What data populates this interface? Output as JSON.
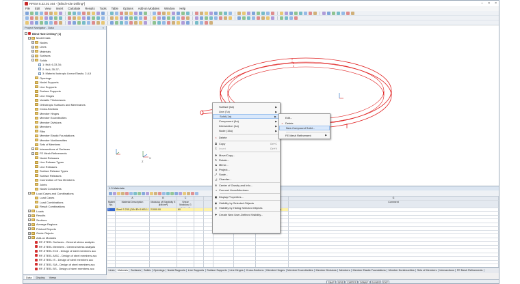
{
  "window": {
    "title": "RFEM 5.22.01 x64 - [Blind Hole Drilling*]",
    "controls": [
      "–",
      "□",
      "×"
    ]
  },
  "menu": [
    "File",
    "Edit",
    "View",
    "Insert",
    "Calculate",
    "Results",
    "Tools",
    "Table",
    "Options",
    "Add-on Modules",
    "Window",
    "Help"
  ],
  "navigator": {
    "title": "Project Navigator - Data",
    "tree": [
      {
        "label": "Blind Hole Drilling* [1]",
        "level": 0,
        "icon": "red",
        "exp": "-",
        "bold": true
      },
      {
        "label": "Model Data",
        "level": 1,
        "icon": "folder",
        "exp": "-"
      },
      {
        "label": "Nodes",
        "level": 2,
        "icon": "folder",
        "exp": "+"
      },
      {
        "label": "Lines",
        "level": 2,
        "icon": "folder",
        "exp": "+"
      },
      {
        "label": "Materials",
        "level": 2,
        "icon": "folder",
        "exp": "+"
      },
      {
        "label": "Surfaces",
        "level": 2,
        "icon": "folder",
        "exp": "+"
      },
      {
        "label": "Solids",
        "level": 2,
        "icon": "folder",
        "exp": "-"
      },
      {
        "label": "1: Null; 6,33,34;",
        "level": 3,
        "icon": "doc",
        "exp": ""
      },
      {
        "label": "2: Null; 35-37;",
        "level": 3,
        "icon": "doc",
        "exp": ""
      },
      {
        "label": "3: Material Isotropic Linear Elastic; 2,4,5",
        "level": 3,
        "icon": "doc",
        "exp": ""
      },
      {
        "label": "Openings",
        "level": 2,
        "icon": "folder",
        "exp": ""
      },
      {
        "label": "Nodal Supports",
        "level": 2,
        "icon": "folder",
        "exp": ""
      },
      {
        "label": "Line Supports",
        "level": 2,
        "icon": "folder",
        "exp": ""
      },
      {
        "label": "Surface Supports",
        "level": 2,
        "icon": "folder",
        "exp": ""
      },
      {
        "label": "Line Hinges",
        "level": 2,
        "icon": "folder",
        "exp": ""
      },
      {
        "label": "Variable Thicknesses",
        "level": 2,
        "icon": "folder",
        "exp": ""
      },
      {
        "label": "Orthotropic Surfaces and Membranes",
        "level": 2,
        "icon": "folder",
        "exp": ""
      },
      {
        "label": "Cross-Sections",
        "level": 2,
        "icon": "folder",
        "exp": ""
      },
      {
        "label": "Member Hinges",
        "level": 2,
        "icon": "folder",
        "exp": ""
      },
      {
        "label": "Member Eccentricities",
        "level": 2,
        "icon": "folder",
        "exp": ""
      },
      {
        "label": "Member Divisions",
        "level": 2,
        "icon": "folder",
        "exp": ""
      },
      {
        "label": "Members",
        "level": 2,
        "icon": "folder",
        "exp": ""
      },
      {
        "label": "Ribs",
        "level": 2,
        "icon": "folder",
        "exp": ""
      },
      {
        "label": "Member Elastic Foundations",
        "level": 2,
        "icon": "folder",
        "exp": ""
      },
      {
        "label": "Member Nonlinearities",
        "level": 2,
        "icon": "folder",
        "exp": ""
      },
      {
        "label": "Sets of Members",
        "level": 2,
        "icon": "folder",
        "exp": ""
      },
      {
        "label": "Intersections of Surfaces",
        "level": 2,
        "icon": "folder",
        "exp": "+"
      },
      {
        "label": "FE Mesh Refinements",
        "level": 2,
        "icon": "folder",
        "exp": "+"
      },
      {
        "label": "Nodal Releases",
        "level": 2,
        "icon": "folder",
        "exp": ""
      },
      {
        "label": "Line Release Types",
        "level": 2,
        "icon": "folder",
        "exp": ""
      },
      {
        "label": "Line Releases",
        "level": 2,
        "icon": "folder",
        "exp": ""
      },
      {
        "label": "Surface Release Types",
        "level": 2,
        "icon": "folder",
        "exp": ""
      },
      {
        "label": "Surface Releases",
        "level": 2,
        "icon": "folder",
        "exp": ""
      },
      {
        "label": "Connection of Two Members",
        "level": 2,
        "icon": "folder",
        "exp": ""
      },
      {
        "label": "Joints",
        "level": 2,
        "icon": "folder",
        "exp": ""
      },
      {
        "label": "Nodal Constraints",
        "level": 2,
        "icon": "folder",
        "exp": ""
      },
      {
        "label": "Load Cases and Combinations",
        "level": 1,
        "icon": "folder",
        "exp": "-"
      },
      {
        "label": "Load Cases",
        "level": 2,
        "icon": "folder",
        "exp": ""
      },
      {
        "label": "Load Combinations",
        "level": 2,
        "icon": "folder",
        "exp": ""
      },
      {
        "label": "Result Combinations",
        "level": 2,
        "icon": "folder",
        "exp": ""
      },
      {
        "label": "Loads",
        "level": 1,
        "icon": "folder",
        "exp": "+"
      },
      {
        "label": "Results",
        "level": 1,
        "icon": "folder",
        "exp": "+"
      },
      {
        "label": "Sections",
        "level": 1,
        "icon": "folder",
        "exp": "+"
      },
      {
        "label": "Average Regions",
        "level": 1,
        "icon": "folder",
        "exp": "+"
      },
      {
        "label": "Printout Reports",
        "level": 1,
        "icon": "folder",
        "exp": "+"
      },
      {
        "label": "Guide Objects",
        "level": 1,
        "icon": "folder",
        "exp": "+"
      },
      {
        "label": "Add-on Modules",
        "level": 1,
        "icon": "folder",
        "exp": "-"
      },
      {
        "label": "RF-STEEL Surfaces - General stress analysis",
        "level": 2,
        "icon": "red",
        "exp": ""
      },
      {
        "label": "RF-STEEL Members - General stress analysis",
        "level": 2,
        "icon": "red",
        "exp": ""
      },
      {
        "label": "RF-STEEL EC3 - Design of steel members acc",
        "level": 2,
        "icon": "red",
        "exp": ""
      },
      {
        "label": "RF-STEEL AISC - Design of steel members acc",
        "level": 2,
        "icon": "red",
        "exp": ""
      },
      {
        "label": "RF-STEEL IS - Design of steel members acc",
        "level": 2,
        "icon": "red",
        "exp": ""
      },
      {
        "label": "RF-STEEL SIA - Design of steel members acc",
        "level": 2,
        "icon": "red",
        "exp": ""
      },
      {
        "label": "RF-STEEL BS - Design of steel members acc",
        "level": 2,
        "icon": "red",
        "exp": ""
      }
    ],
    "tabs": [
      "Data",
      "Display",
      "Views"
    ]
  },
  "table": {
    "title": "1.3 Materials",
    "column_letters": [
      "A",
      "B",
      "C",
      "D",
      "E",
      "F",
      "G",
      "H",
      "I"
    ],
    "headers": [
      "Material No.",
      "Material Description",
      "Modulus of Elasticity E [kN/cm²]",
      "Shear Modulus G [kN/cm²]",
      "",
      "",
      "Th. Exp. [1/°C]",
      "Partial Factor γM [-]",
      "Material Model",
      "Comment"
    ],
    "rows": [
      [
        "1",
        "Steel S 235 | DIN EN 1993-1-1:2010-12",
        "21000.00",
        "80",
        "",
        "",
        "",
        "1.00",
        "Isotropic Linear Elastic",
        ""
      ]
    ],
    "sheet_tabs": [
      "Lines",
      "Materials",
      "Surfaces",
      "Solids",
      "Openings",
      "Nodal Supports",
      "Line Supports",
      "Surface Supports",
      "Line Hinges",
      "Cross-Sections",
      "Member Hinges",
      "Member Eccentricities",
      "Member Divisions",
      "Members",
      "Member Elastic Foundations",
      "Member Nonlinearities",
      "Sets of Members",
      "Intersections",
      "FE Mesh Refinements"
    ],
    "active_tab": "Materials"
  },
  "context_menu": {
    "items": [
      {
        "label": "Surface (6a)",
        "arrow": true
      },
      {
        "label": "Line (7a)",
        "arrow": true
      },
      {
        "label": "Solid (1a)",
        "arrow": true,
        "highlight": true
      },
      {
        "label": "Component (4a)",
        "arrow": true
      },
      {
        "label": "Intersection (1a)",
        "arrow": true
      },
      {
        "label": "Node (15a)",
        "arrow": true
      },
      {
        "sep": true
      },
      {
        "label": "Delete",
        "icon": "×",
        "icon_color": "#c62828"
      },
      {
        "sep": true
      },
      {
        "label": "Copy",
        "shortcut": "Ctrl+C",
        "icon": "⧉"
      },
      {
        "label": "Insert",
        "shortcut": "Ctrl+V",
        "disabled": true,
        "icon": "⎘"
      },
      {
        "sep": true
      },
      {
        "label": "Move/Copy...",
        "icon": "✥"
      },
      {
        "label": "Rotate...",
        "icon": "↻"
      },
      {
        "label": "Mirror...",
        "icon": "⇋"
      },
      {
        "label": "Project...",
        "icon": "⇲"
      },
      {
        "label": "Scale...",
        "icon": "⤢"
      },
      {
        "label": "Chamfer...",
        "icon": "◿"
      },
      {
        "sep": true
      },
      {
        "label": "Center of Gravity and Info...",
        "icon": "⊕"
      },
      {
        "label": "Connect Lines/Members",
        "icon": "⊸"
      },
      {
        "sep": true
      },
      {
        "label": "Display Properties...",
        "icon": "▣"
      },
      {
        "sep": true
      },
      {
        "label": "Visibility by Selected Objects",
        "icon": "◉"
      },
      {
        "label": "Visibility by Hiding Selected Objects",
        "icon": "◎"
      },
      {
        "sep": true
      },
      {
        "label": "Create New User-Defined Visibility...",
        "icon": "✚"
      }
    ]
  },
  "submenu": {
    "items": [
      {
        "label": "Edit..."
      },
      {
        "label": "Delete",
        "icon": "×"
      },
      {
        "label": "New Compound Solid...",
        "highlight": true
      },
      {
        "label": "FE Mesh Refinement",
        "arrow": true
      }
    ]
  },
  "axes": {
    "x": "X",
    "y": "Y",
    "z": "Z"
  },
  "status_buttons": [
    "SNAP",
    "GRID",
    "CARTES",
    "OSNAP",
    "GLINES",
    "DXF"
  ],
  "colors": {
    "model": "#e02020",
    "highlight": "#d9e8fb",
    "selected_row": "#fff3a6"
  }
}
